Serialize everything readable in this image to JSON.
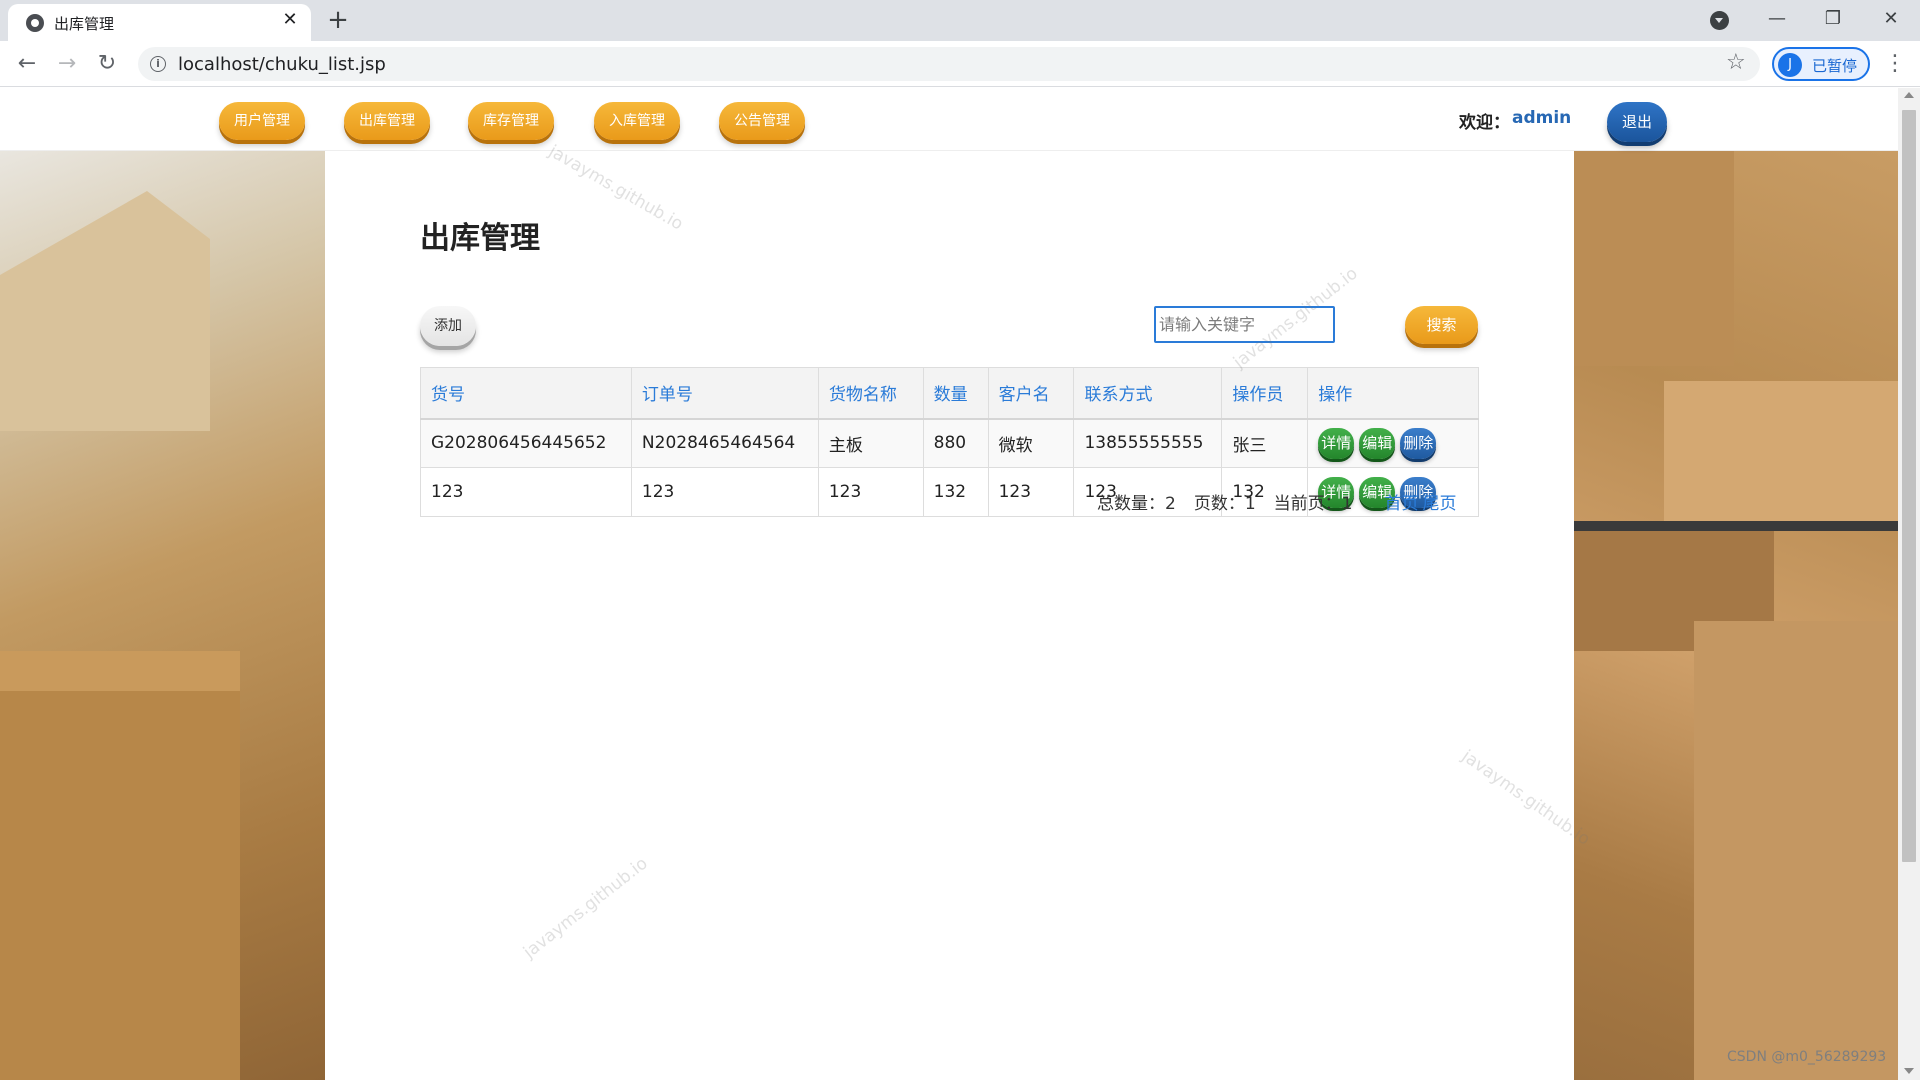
{
  "browser": {
    "tab_title": "出库管理",
    "url": "localhost/chuku_list.jsp",
    "profile_initial": "J",
    "profile_label": "已暂停"
  },
  "nav": {
    "items": [
      {
        "label": "用户管理"
      },
      {
        "label": "出库管理"
      },
      {
        "label": "库存管理"
      },
      {
        "label": "入库管理"
      },
      {
        "label": "公告管理"
      }
    ],
    "welcome_label": "欢迎：",
    "username": "admin",
    "logout_label": "退出"
  },
  "main": {
    "title": "出库管理",
    "add_label": "添加",
    "search": {
      "placeholder": "请输入关键字",
      "value": "",
      "button_label": "搜索"
    }
  },
  "table": {
    "headers": [
      "货号",
      "订单号",
      "货物名称",
      "数量",
      "客户名",
      "联系方式",
      "操作员",
      "操作"
    ],
    "rows": [
      [
        "G202806456445652",
        "N2028465464564",
        "主板",
        "880",
        "微软",
        "13855555555",
        "张三"
      ],
      [
        "123",
        "123",
        "123",
        "132",
        "123",
        "123",
        "132"
      ]
    ],
    "actions": {
      "detail": "详情",
      "edit": "编辑",
      "delete": "删除"
    }
  },
  "pagination": {
    "total": "总数量：2",
    "pages": "页数：1",
    "current": "当前页：1",
    "first": "首页",
    "last": "尾页"
  },
  "watermark_text": "javayms.github.io",
  "footer_credit": "CSDN @m0_56289293",
  "colors": {
    "accent_orange": "#e99a1a",
    "accent_blue": "#1b559c",
    "action_green": "#24862c",
    "link_blue": "#2a7bd8"
  },
  "icons": [
    "globe-icon",
    "close-icon",
    "plus-icon",
    "back-icon",
    "forward-icon",
    "reload-icon",
    "info-icon",
    "star-icon",
    "kebab-menu-icon",
    "chevron-down-icon"
  ]
}
